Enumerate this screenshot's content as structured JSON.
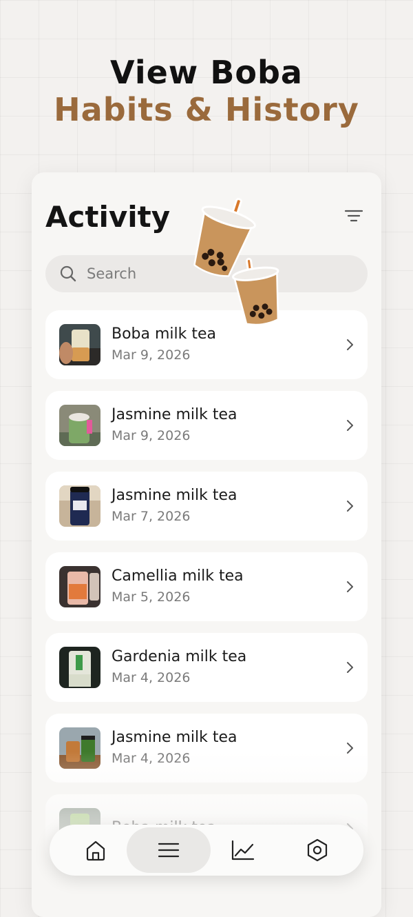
{
  "promo": {
    "line1": "View Boba",
    "line2": "Habits & History",
    "accent_color": "#9a6a3c"
  },
  "header": {
    "title": "Activity",
    "filter_icon": "filter-lines-icon"
  },
  "search": {
    "placeholder": "Search",
    "value": "",
    "icon": "search-icon"
  },
  "activity": {
    "items": [
      {
        "name": "Boba milk tea",
        "date": "Mar 9, 2026"
      },
      {
        "name": "Jasmine milk tea",
        "date": "Mar 9, 2026"
      },
      {
        "name": "Jasmine milk tea",
        "date": "Mar 7, 2026"
      },
      {
        "name": "Camellia milk tea",
        "date": "Mar 5, 2026"
      },
      {
        "name": "Gardenia milk tea",
        "date": "Mar 4, 2026"
      },
      {
        "name": "Jasmine milk tea",
        "date": "Mar 4, 2026"
      },
      {
        "name": "Boba milk tea",
        "date": ""
      }
    ]
  },
  "nav": {
    "tabs": [
      {
        "icon": "home-icon",
        "active": false
      },
      {
        "icon": "list-icon",
        "active": true
      },
      {
        "icon": "chart-icon",
        "active": false
      },
      {
        "icon": "settings-hexagon-icon",
        "active": false
      }
    ]
  }
}
